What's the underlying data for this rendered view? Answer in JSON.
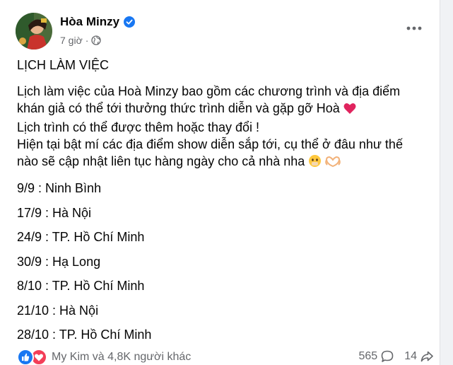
{
  "post": {
    "author": "Hòa Minzy",
    "time": "7 giờ",
    "heading": "LỊCH LÀM VIỆC",
    "para1_a": "Lịch làm việc của Hoà Minzy bao gồm các chương trình và địa điểm",
    "para1_b": "khán giả có thể tới thưởng thức trình diễn và gặp gỡ Hoà",
    "para1_c": "Lịch trình có thể được thêm hoặc thay đổi !",
    "para1_d": "Hiện tại bật mí các địa điểm show diễn sắp tới, cụ thể ở đâu như thế",
    "para1_e": "nào sẽ cập nhật liên tục hàng ngày cho cả nhà nha",
    "schedule": [
      "9/9 : Ninh Bình",
      "17/9 : Hà Nội",
      "24/9 : TP. Hồ Chí Minh",
      "30/9 : Hạ Long",
      "8/10 : TP. Hồ Chí Minh",
      "21/10 : Hà Nội",
      "28/10 : TP. Hồ Chí Minh"
    ]
  },
  "footer": {
    "reactors": "My Kim và 4,8K người khác",
    "comments": "565",
    "shares": "14"
  },
  "icons": {
    "verified": "verified-badge-icon",
    "audience": "globe-icon",
    "more": "more-options-icon",
    "heart_emoji": "red-heart-emoji",
    "face_emoji": "blushing-face-emoji",
    "hands_emoji": "heart-hands-emoji",
    "like": "like-reaction-icon",
    "love": "love-reaction-icon",
    "comment": "comment-icon",
    "share": "share-icon"
  },
  "colors": {
    "verified": "#1877f2",
    "like": "#1877f2",
    "love": "#f33e58",
    "secondary_text": "#65676b"
  }
}
